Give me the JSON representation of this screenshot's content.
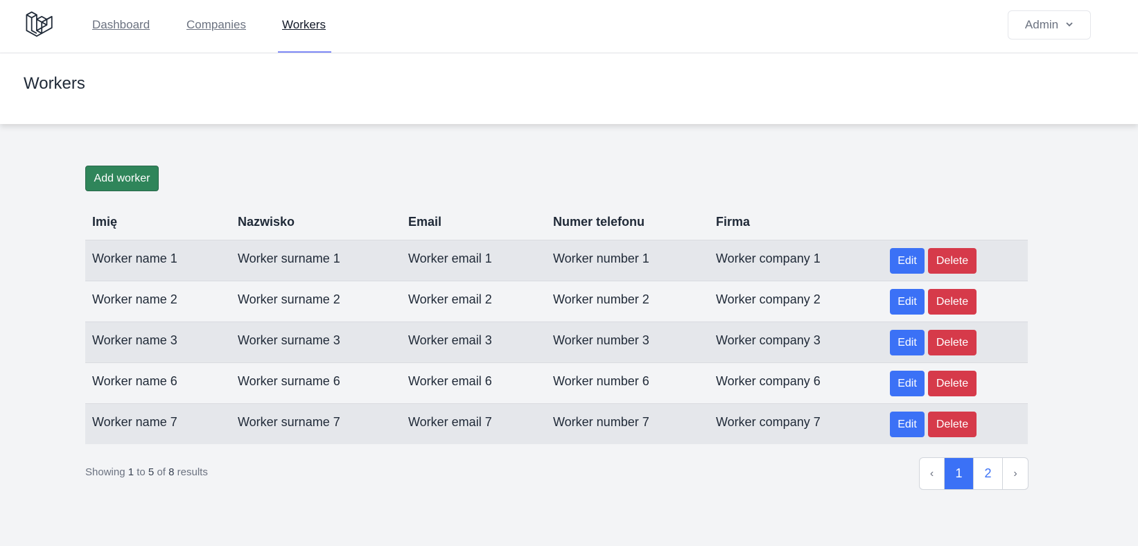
{
  "nav": {
    "links": [
      {
        "label": "Dashboard"
      },
      {
        "label": "Companies"
      },
      {
        "label": "Workers"
      }
    ],
    "active": "Workers",
    "user_label": "Admin"
  },
  "page": {
    "title": "Workers",
    "add_button": "Add worker"
  },
  "table": {
    "headers": [
      "Imię",
      "Nazwisko",
      "Email",
      "Numer telefonu",
      "Firma"
    ],
    "rows": [
      {
        "name": "Worker name 1",
        "surname": "Worker surname 1",
        "email": "Worker email 1",
        "phone": "Worker number 1",
        "company": "Worker company 1"
      },
      {
        "name": "Worker name 2",
        "surname": "Worker surname 2",
        "email": "Worker email 2",
        "phone": "Worker number 2",
        "company": "Worker company 2"
      },
      {
        "name": "Worker name 3",
        "surname": "Worker surname 3",
        "email": "Worker email 3",
        "phone": "Worker number 3",
        "company": "Worker company 3"
      },
      {
        "name": "Worker name 6",
        "surname": "Worker surname 6",
        "email": "Worker email 6",
        "phone": "Worker number 6",
        "company": "Worker company 6"
      },
      {
        "name": "Worker name 7",
        "surname": "Worker surname 7",
        "email": "Worker email 7",
        "phone": "Worker number 7",
        "company": "Worker company 7"
      }
    ],
    "edit_label": "Edit",
    "delete_label": "Delete"
  },
  "pagination": {
    "showing_prefix": "Showing",
    "from": "1",
    "to_word": "to",
    "to": "5",
    "of_word": "of",
    "total": "8",
    "results_word": "results",
    "prev": "‹",
    "next": "›",
    "pages": [
      "1",
      "2"
    ],
    "current": "1"
  },
  "colors": {
    "add_button": "#2f855a",
    "edit_button": "#3b71f6",
    "delete_button": "#d63a4a",
    "nav_active_underline": "#818cf8",
    "page_background": "#f3f4f6"
  },
  "icons": {
    "logo": "laravel-logo-icon",
    "admin_dropdown": "chevron-down-icon"
  }
}
